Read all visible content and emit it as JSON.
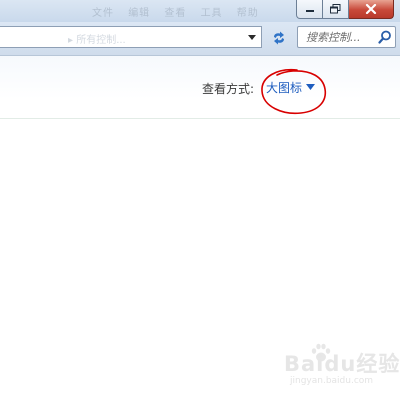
{
  "window": {
    "menu_faded": [
      "文件",
      "编辑",
      "查看",
      "工具",
      "帮助"
    ]
  },
  "address_bar": {
    "text_faded": "▸ 所有控制..."
  },
  "search": {
    "placeholder": "搜索控制..."
  },
  "view_options": {
    "label": "查看方式:",
    "selected": "大图标"
  },
  "annotation": {
    "color": "#d80000"
  },
  "watermark": {
    "main": "Baidu经验",
    "sub": "jingyan.baidu.com"
  },
  "colors": {
    "link_blue": "#1e5dbf",
    "close_red": "#c8493a"
  }
}
